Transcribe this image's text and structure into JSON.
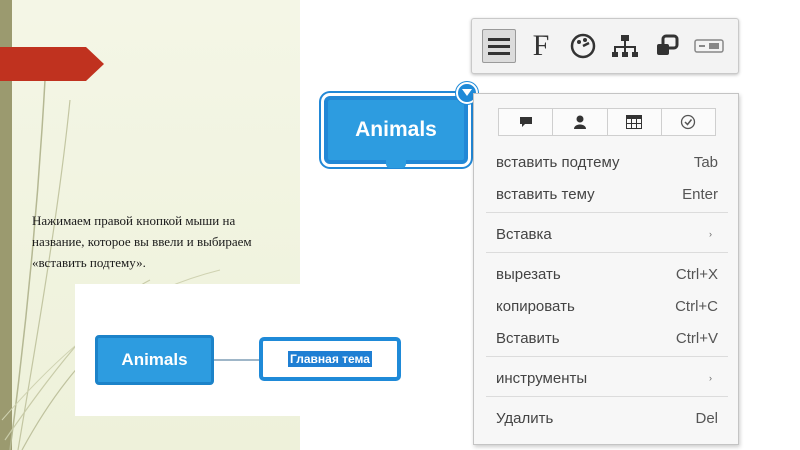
{
  "caption": "Нажимаем правой кнопкой мыши на название, которое вы ввели и выбираем «вставить подтему».",
  "nodes": {
    "main_label": "Animals",
    "lower_label": "Animals",
    "new_topic_label": "Главная тема"
  },
  "toolbar": {
    "buttons": [
      {
        "icon": "menu-icon",
        "active": true
      },
      {
        "icon": "font-icon",
        "glyph": "F"
      },
      {
        "icon": "palette-icon"
      },
      {
        "icon": "structure-icon"
      },
      {
        "icon": "link-icon"
      },
      {
        "icon": "toggle-icon"
      }
    ]
  },
  "menu": {
    "icon_buttons": [
      "comment-icon",
      "user-icon",
      "table-icon",
      "check-icon"
    ],
    "items": [
      {
        "label": "вставить подтему",
        "shortcut": "Tab"
      },
      {
        "label": "вставить тему",
        "shortcut": "Enter"
      },
      {
        "label": "Вставка",
        "submenu": "›"
      },
      {
        "label": "вырезать",
        "shortcut": "Ctrl+X"
      },
      {
        "label": "копировать",
        "shortcut": "Ctrl+C"
      },
      {
        "label": "Вставить",
        "shortcut": "Ctrl+V"
      },
      {
        "label": "инструменты",
        "submenu": "›"
      },
      {
        "label": "Удалить",
        "shortcut": "Del"
      }
    ]
  },
  "colors": {
    "node_blue": "#2d9ce0",
    "accent_red": "#c0321f",
    "panel_bg": "#f4f6e6"
  }
}
